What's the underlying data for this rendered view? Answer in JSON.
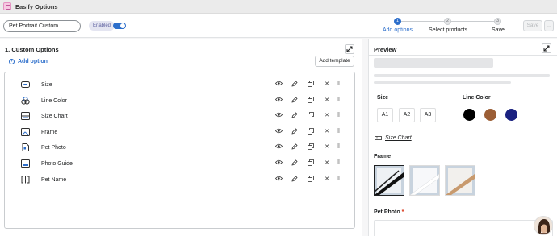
{
  "window": {
    "title": "Easify Options"
  },
  "header": {
    "name_value": "Pet Portrait Custom",
    "enabled_label": "Enabled",
    "steps": [
      {
        "number": "1",
        "label": "Add options"
      },
      {
        "number": "2",
        "label": "Select products"
      },
      {
        "number": "3",
        "label": "Save"
      }
    ],
    "save_label": "Save",
    "more_label": "…"
  },
  "left": {
    "section_title": "1. Custom Options",
    "add_option_label": "Add option",
    "add_template_label": "Add template",
    "options": [
      {
        "label": "Size",
        "icon": "size-icon"
      },
      {
        "label": "Line Color",
        "icon": "color-icon"
      },
      {
        "label": "Size Chart",
        "icon": "size-chart-icon"
      },
      {
        "label": "Frame",
        "icon": "frame-icon"
      },
      {
        "label": "Pet Photo",
        "icon": "photo-upload-icon"
      },
      {
        "label": "Photo Guide",
        "icon": "photo-guide-icon"
      },
      {
        "label": "Pet Name",
        "icon": "text-icon"
      }
    ]
  },
  "preview": {
    "title": "Preview",
    "size_label": "Size",
    "sizes": [
      "A1",
      "A2",
      "A3"
    ],
    "line_color_label": "Line Color",
    "colors": [
      "#000000",
      "#9b5e35",
      "#1a2180"
    ],
    "size_chart_label": "Size Chart",
    "frame_label": "Frame",
    "pet_photo_label": "Pet Photo",
    "required_mark": "*"
  }
}
